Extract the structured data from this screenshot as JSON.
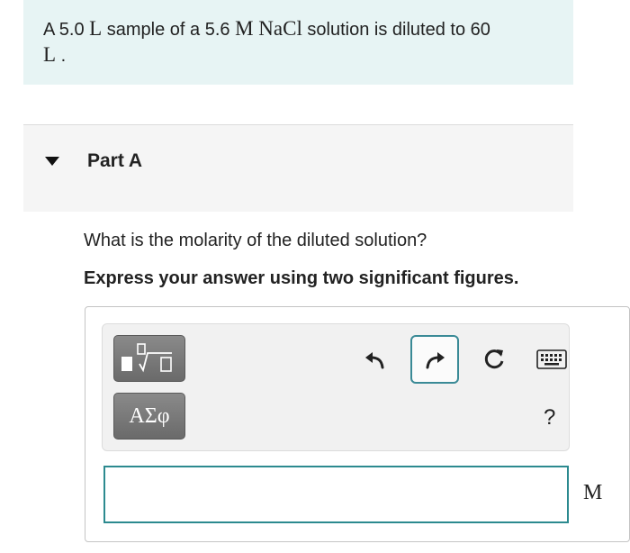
{
  "intro": {
    "prefix": "A 5.0 ",
    "unit_l1": "L",
    "mid1": " sample of a 5.6 ",
    "unit_m": "M",
    "space": " ",
    "formula": "NaCl",
    "mid2": " solution is diluted to 60",
    "unit_l2": "L",
    "period": " ."
  },
  "part": {
    "title": "Part A"
  },
  "question": "What is the molarity of the diluted solution?",
  "instruction": "Express your answer using two significant figures.",
  "toolbar": {
    "symbols_label": "ΑΣφ",
    "help_label": "?"
  },
  "answer": {
    "value": "",
    "unit": "M"
  },
  "colors": {
    "intro_bg": "#e7f4f4",
    "accent": "#2c8a8f"
  }
}
